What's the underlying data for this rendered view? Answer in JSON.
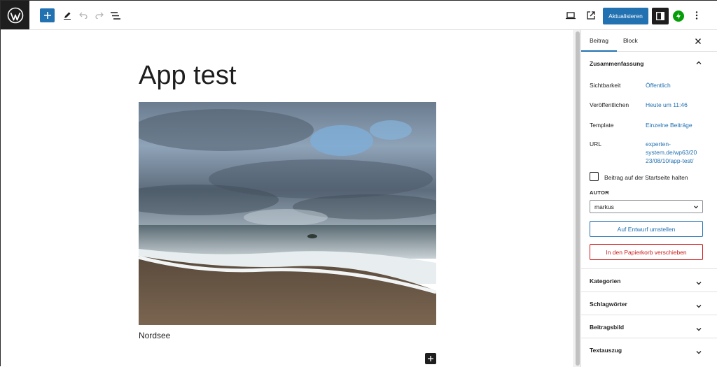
{
  "toolbar": {
    "update_label": "Aktualisieren"
  },
  "post": {
    "title": "App test",
    "caption": "Nordsee"
  },
  "sidebar": {
    "tabs": [
      "Beitrag",
      "Block"
    ],
    "summary_title": "Zusammenfassung",
    "rows": [
      {
        "label": "Sichtbarkeit",
        "value": "Öffentlich"
      },
      {
        "label": "Veröffentlichen",
        "value": "Heute um 11:46"
      },
      {
        "label": "Template",
        "value": "Einzelne Beiträge"
      },
      {
        "label": "URL",
        "value_lines": [
          "experten-",
          "system.de/wp63/20",
          "23/08/10/app-test/"
        ]
      }
    ],
    "sticky_label": "Beitrag auf der Startseite halten",
    "author_label": "AUTOR",
    "author_value": "markus",
    "draft_button": "Auf Entwurf umstellen",
    "trash_button": "In den Papierkorb verschieben",
    "sections": [
      "Kategorien",
      "Schlagwörter",
      "Beitragsbild",
      "Textauszug"
    ]
  },
  "colors": {
    "accent": "#2271b1",
    "danger": "#cc1818",
    "dark": "#1e1e1e",
    "jetpack": "#069e08"
  }
}
